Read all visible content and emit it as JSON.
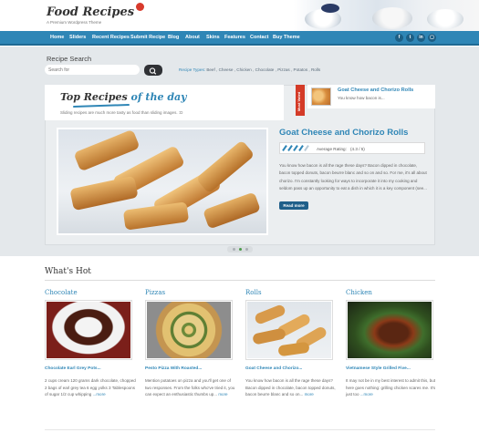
{
  "site": {
    "logo_title": "Food Recipes",
    "logo_subtitle": "A Premium Wordpress Theme"
  },
  "nav": {
    "items": [
      "Home",
      "Sliders",
      "Recent Recipes",
      "Submit Recipe",
      "Blog",
      "About",
      "Skins",
      "Features",
      "Contact",
      "Buy Theme"
    ],
    "social": [
      "f",
      "t",
      "in",
      "▢"
    ]
  },
  "search": {
    "heading": "Recipe Search",
    "placeholder": "Search for",
    "types_label": "Recipe Types:",
    "types_list": "Beef , Cheese , Chicken , Chocolate , Pizzas , Potatos , Rolls"
  },
  "slider": {
    "title_start": "Top Recipes ",
    "title_highlight": "of the day",
    "note": "Sliding recipes are much more tasty as food than sliding images. :D",
    "most_voted_label": "Most Voted",
    "most_voted_title": "Goat Cheese and Chorizo Rolls",
    "most_voted_text": "You know how bacon is...",
    "featured_title": "Goat Cheese and Chorizo Rolls",
    "rating_label": "Average Rating:",
    "rating_value": "(4.3 / 5)",
    "rating_spoons": 4.3,
    "featured_desc": "You know how bacon is all the rage these days? Bacon dipped in chocolate, bacon topped donuts, bacon beurre blanc and so on and so. For me, it's all about chorizo. I'm constantly looking for ways to incorporate it into my cooking and seldom pass up an opportunity to eat a dish in which it is a key component (see...",
    "read_more": "Read more",
    "slide_count": 3,
    "active_slide": 2
  },
  "whats_hot": {
    "heading": "What's Hot",
    "items": [
      {
        "category": "Chocolate",
        "title": "Chocolate Earl Grey Pots...",
        "desc": "2 cups cream 120 grams dark chocolate, chopped 2 bags of earl grey tea 6 egg yolks 3 Tablespoons of sugar 1/2 cup whipping",
        "more": "...more"
      },
      {
        "category": "Pizzas",
        "title": "Pesto Pizza With Roasted...",
        "desc": "Mention potatoes on pizza and you'll get one of two responses. From the folks who've tried it, you can expect an enthusiastic thumbs up...",
        "more": "more"
      },
      {
        "category": "Rolls",
        "title": "Goat Cheese and Chorizo...",
        "desc": "You know how bacon is all the rage these days? Bacon dipped in chocolate, bacon topped donuts, bacon beurre blanc and so on...",
        "more": "more"
      },
      {
        "category": "Chicken",
        "title": "Vietnamese Style Grilled Five...",
        "desc": "It may not be in my best interest to admit this, but here goes nothing: grilling chicken scares me. It's just too",
        "more": "...more"
      }
    ]
  },
  "colors": {
    "accent": "#2f86b6",
    "nav_bar": "#2f86b6",
    "most_voted_ribbon": "#d43b28",
    "band": "#e4e8eb"
  }
}
